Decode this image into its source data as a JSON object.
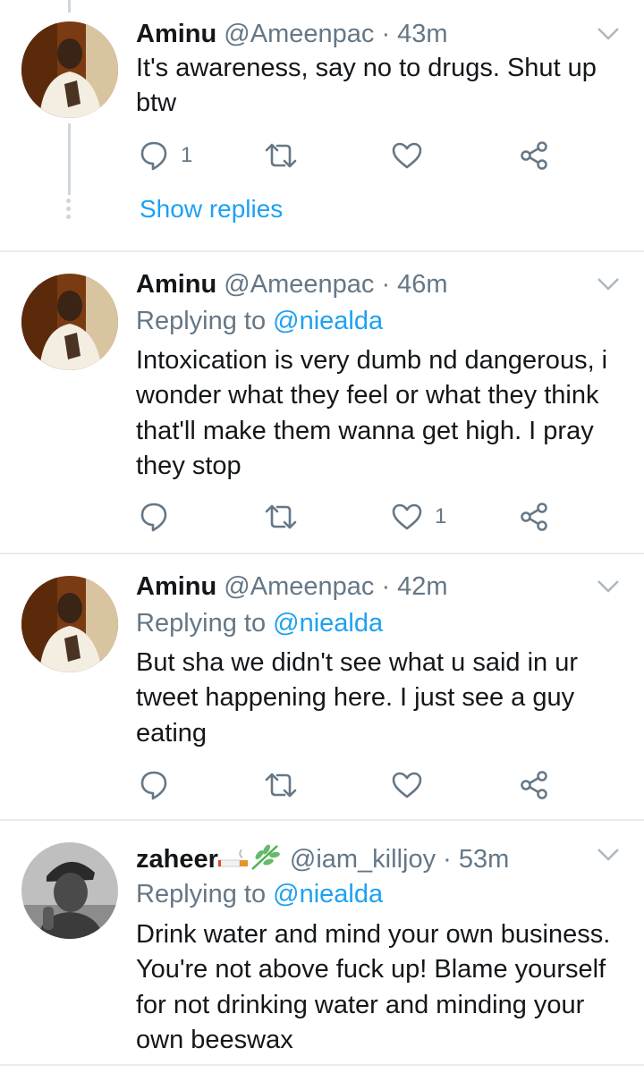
{
  "tweets": [
    {
      "name": "Aminu",
      "handle": "@Ameenpac",
      "time": "43m",
      "replying_label": "",
      "replying_to": "",
      "text": "It's awareness, say no to drugs. Shut up btw",
      "reply_count": "1",
      "like_count": "",
      "show_replies": "Show replies"
    },
    {
      "name": "Aminu",
      "handle": "@Ameenpac",
      "time": "46m",
      "replying_label": "Replying to",
      "replying_to": "@niealda",
      "text": "Intoxication is very dumb nd dangerous, i wonder what they feel or what they think that'll make them wanna get high. I pray they stop",
      "reply_count": "",
      "like_count": "1"
    },
    {
      "name": "Aminu",
      "handle": "@Ameenpac",
      "time": "42m",
      "replying_label": "Replying to",
      "replying_to": "@niealda",
      "text": "But sha we didn't see what u said in ur tweet happening here. I just see a guy eating",
      "reply_count": "",
      "like_count": ""
    },
    {
      "name": "zaheer",
      "name_emoji_icons": [
        "cigarette-icon",
        "herb-icon"
      ],
      "handle": "@iam_killjoy",
      "time": "53m",
      "replying_label": "Replying to",
      "replying_to": "@niealda",
      "text": "Drink water and mind your own business. You're not above fuck up! Blame yourself for not drinking water and minding your own beeswax"
    }
  ],
  "separator": "·",
  "colors": {
    "link": "#1da1f2",
    "secondary": "#657786",
    "divider": "#e6ecf0",
    "thread_line": "#ccd6dd"
  }
}
